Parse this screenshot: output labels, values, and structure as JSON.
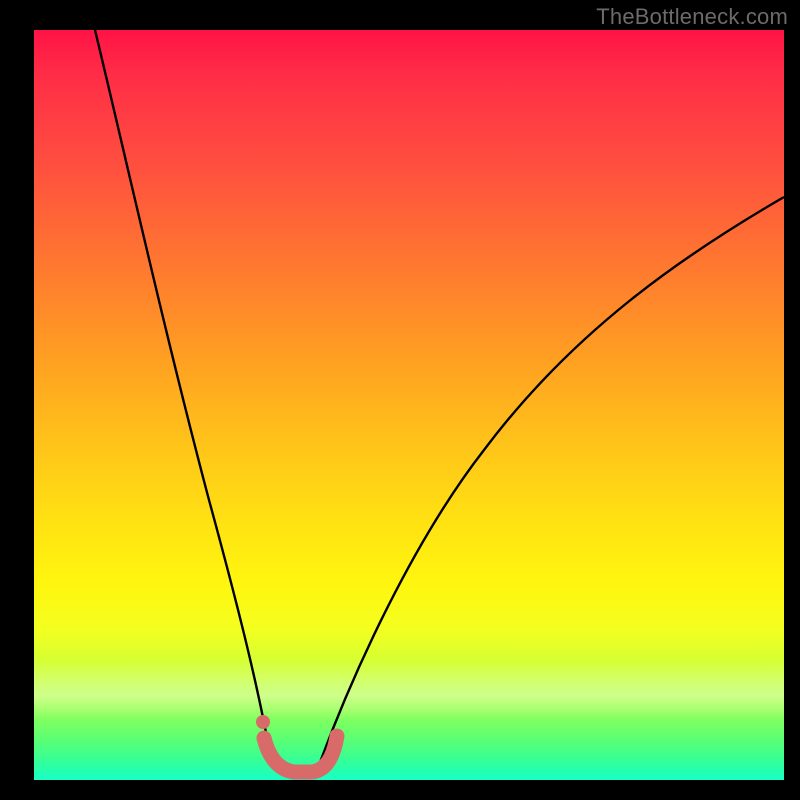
{
  "watermark": "TheBottleneck.com",
  "colors": {
    "background_frame": "#000000",
    "gradient_top": "#ff1345",
    "gradient_mid1": "#ff7a2f",
    "gradient_mid2": "#ffe312",
    "gradient_bottom": "#18ffc8",
    "curve": "#000000",
    "marker": "#d86a6a"
  },
  "chart_data": {
    "type": "line",
    "title": "",
    "xlabel": "",
    "ylabel": "",
    "xlim": [
      0,
      100
    ],
    "ylim": [
      0,
      100
    ],
    "grid": false,
    "legend": false,
    "series": [
      {
        "name": "left-branch",
        "x": [
          8,
          10,
          12,
          14,
          16,
          18,
          20,
          22,
          24,
          26,
          28,
          30,
          31.5
        ],
        "y": [
          100,
          92,
          83,
          75,
          66,
          57,
          48,
          39,
          30,
          21,
          13,
          6,
          2
        ]
      },
      {
        "name": "right-branch",
        "x": [
          38,
          40,
          44,
          48,
          52,
          56,
          60,
          66,
          72,
          78,
          85,
          92,
          100
        ],
        "y": [
          2,
          6,
          14,
          22,
          29,
          36,
          42,
          50,
          57,
          63,
          69,
          74,
          78
        ]
      },
      {
        "name": "bottom-marker-band",
        "x": [
          31,
          32,
          33,
          34,
          35,
          36,
          37,
          38
        ],
        "y": [
          3.5,
          2,
          1.2,
          1,
          1,
          1.2,
          2,
          3.5
        ]
      }
    ],
    "annotations": [
      {
        "text": "TheBottleneck.com",
        "position": "top-right"
      }
    ]
  }
}
